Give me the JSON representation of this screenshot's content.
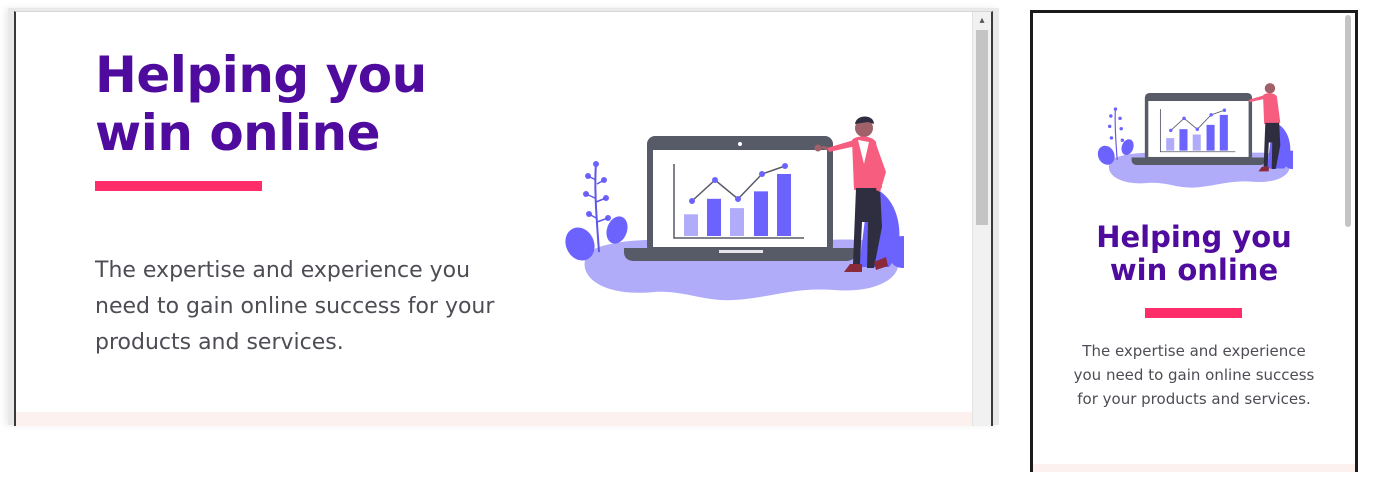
{
  "hero": {
    "title_line1": "Helping you",
    "title_line2": "win online",
    "description": "The expertise and experience you need to gain online success for your products and services."
  },
  "illustration": {
    "name": "analytics-laptop-illustration",
    "bar_levels": [
      0.35,
      0.6,
      0.45,
      0.72,
      1.0
    ]
  },
  "colors": {
    "title": "#4f0a9e",
    "accent_bar": "#ff2e6b",
    "body_text": "#4d4d55",
    "illustration_purple": "#6c63ff",
    "illustration_light_purple": "#b0acfa",
    "person_shirt": "#f65d7f",
    "bottom_section_bg": "#fdf1ef"
  }
}
